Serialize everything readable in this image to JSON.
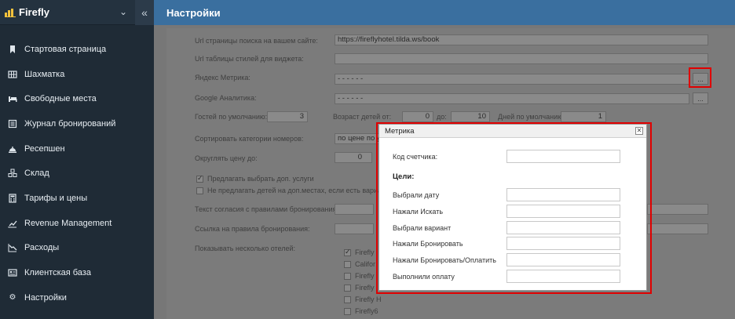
{
  "brand": {
    "name": "Firefly"
  },
  "sidebar": {
    "items": [
      {
        "label": "Стартовая страница",
        "icon": "bookmark-icon"
      },
      {
        "label": "Шахматка",
        "icon": "grid-icon"
      },
      {
        "label": "Свободные места",
        "icon": "bed-icon"
      },
      {
        "label": "Журнал бронирований",
        "icon": "journal-icon"
      },
      {
        "label": "Ресепшен",
        "icon": "reception-bell-icon"
      },
      {
        "label": "Склад",
        "icon": "warehouse-icon"
      },
      {
        "label": "Тарифы и цены",
        "icon": "calculator-icon"
      },
      {
        "label": "Revenue Management",
        "icon": "trend-up-icon"
      },
      {
        "label": "Расходы",
        "icon": "trend-down-icon"
      },
      {
        "label": "Клиентская база",
        "icon": "contact-card-icon"
      },
      {
        "label": "Настройки",
        "icon": "gear-icon"
      }
    ]
  },
  "header": {
    "title": "Настройки"
  },
  "form": {
    "search_url_label": "Url страницы поиска на вашем сайте:",
    "search_url_value": "https://fireflyhotel.tilda.ws/book",
    "styles_url_label": "Url таблицы стилей для виджета:",
    "yandex_label": "Яндекс Метрика:",
    "yandex_value": "- - - - - -",
    "google_label": "Google Аналитика:",
    "google_value": "- - - - - -",
    "dots_label": "...",
    "guests_label": "Гостей по умолчанию:",
    "guests_value": "3",
    "child_age_label": "Возраст детей от:",
    "child_age_from": "0",
    "child_age_to_label": "до:",
    "child_age_to": "10",
    "days_label": "Дней по умолчанию:",
    "days_value": "1",
    "sort_label": "Сортировать категории номеров:",
    "sort_value": "по цене по у",
    "round_label": "Округлять цену до:",
    "round_value": "0",
    "offer_services_label": "Предлагать выбрать доп. услуги",
    "no_children_label": "Не предлагать детей на доп.местах, если есть вариа",
    "consent_label": "Текст согласия с правилами бронирования:",
    "rules_link_label": "Ссылка на правила бронирования:",
    "multi_hotels_label": "Показывать несколько отелей:",
    "hotels": [
      "Firefly",
      "Califor",
      "Firefly",
      "Firefly",
      "Firefly H",
      "Firefly6"
    ]
  },
  "modal": {
    "title": "Метрика",
    "close_label": "✕",
    "counter_label": "Код счетчика:",
    "goals_heading": "Цели:",
    "goals": [
      "Выбрали дату",
      "Нажали Искать",
      "Выбрали вариант",
      "Нажали Бронировать",
      "Нажали Бронировать/Оплатить",
      "Выполнили оплату"
    ]
  },
  "colors": {
    "sidebar": "#1f2b36",
    "header": "#3a6f9f",
    "highlight": "#e00000"
  }
}
